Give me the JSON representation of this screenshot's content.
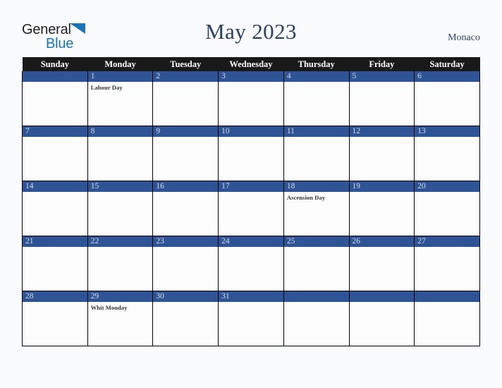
{
  "brand": {
    "name_part1": "General",
    "name_part2": "Blue",
    "triangle_icon": "blue-triangle-icon",
    "accent_color": "#1b75bb",
    "text_color": "#231f20"
  },
  "header": {
    "title": "May 2023",
    "region": "Monaco",
    "title_color": "#2b4064"
  },
  "calendar": {
    "month": "May",
    "year": "2023",
    "header_bg": "#191919",
    "daynum_bg": "#2f5496",
    "daynum_color": "#d6dce8",
    "cell_bg": "#fdfdfd",
    "weekday_headers": [
      "Sunday",
      "Monday",
      "Tuesday",
      "Wednesday",
      "Thursday",
      "Friday",
      "Saturday"
    ],
    "weeks": [
      [
        {
          "day": "",
          "events": []
        },
        {
          "day": "1",
          "events": [
            "Labour Day"
          ]
        },
        {
          "day": "2",
          "events": []
        },
        {
          "day": "3",
          "events": []
        },
        {
          "day": "4",
          "events": []
        },
        {
          "day": "5",
          "events": []
        },
        {
          "day": "6",
          "events": []
        }
      ],
      [
        {
          "day": "7",
          "events": []
        },
        {
          "day": "8",
          "events": []
        },
        {
          "day": "9",
          "events": []
        },
        {
          "day": "10",
          "events": []
        },
        {
          "day": "11",
          "events": []
        },
        {
          "day": "12",
          "events": []
        },
        {
          "day": "13",
          "events": []
        }
      ],
      [
        {
          "day": "14",
          "events": []
        },
        {
          "day": "15",
          "events": []
        },
        {
          "day": "16",
          "events": []
        },
        {
          "day": "17",
          "events": []
        },
        {
          "day": "18",
          "events": [
            "Ascension Day"
          ]
        },
        {
          "day": "19",
          "events": []
        },
        {
          "day": "20",
          "events": []
        }
      ],
      [
        {
          "day": "21",
          "events": []
        },
        {
          "day": "22",
          "events": []
        },
        {
          "day": "23",
          "events": []
        },
        {
          "day": "24",
          "events": []
        },
        {
          "day": "25",
          "events": []
        },
        {
          "day": "26",
          "events": []
        },
        {
          "day": "27",
          "events": []
        }
      ],
      [
        {
          "day": "28",
          "events": []
        },
        {
          "day": "29",
          "events": [
            "Whit Monday"
          ]
        },
        {
          "day": "30",
          "events": []
        },
        {
          "day": "31",
          "events": []
        },
        {
          "day": "",
          "events": []
        },
        {
          "day": "",
          "events": []
        },
        {
          "day": "",
          "events": []
        }
      ]
    ]
  }
}
